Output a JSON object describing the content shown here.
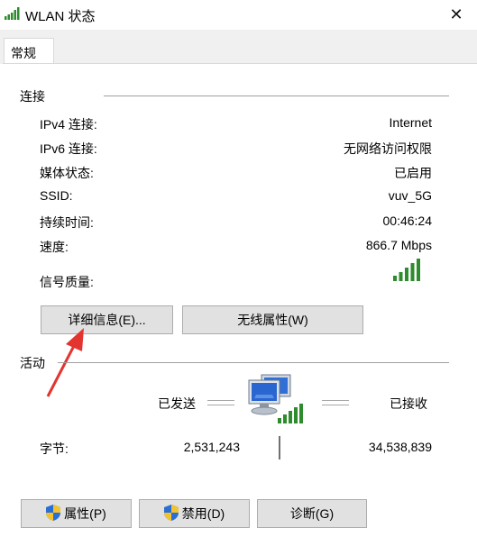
{
  "window": {
    "title": "WLAN 状态",
    "close_symbol": "✕"
  },
  "tabs": [
    {
      "label": "常规"
    }
  ],
  "connection": {
    "title": "连接",
    "rows": [
      {
        "label": "IPv4 连接:",
        "value": "Internet"
      },
      {
        "label": "IPv6 连接:",
        "value": "无网络访问权限"
      },
      {
        "label": "媒体状态:",
        "value": "已启用"
      },
      {
        "label": "SSID:",
        "value": "vuv_5G"
      },
      {
        "label": "持续时间:",
        "value": "00:46:24"
      },
      {
        "label": "速度:",
        "value": "866.7 Mbps"
      }
    ],
    "signal_label": "信号质量:",
    "signal_bars": 5,
    "details_button": "详细信息(E)...",
    "wireless_props_button": "无线属性(W)"
  },
  "activity": {
    "title": "活动",
    "sent_label": "已发送",
    "received_label": "已接收",
    "bytes_label": "字节:",
    "bytes_sent": "2,531,243",
    "bytes_received": "34,538,839"
  },
  "bottom_buttons": {
    "properties": "属性(P)",
    "disable": "禁用(D)",
    "diagnose": "诊断(G)"
  },
  "colors": {
    "accent_green": "#2e8b2e",
    "arrow_red": "#e3342f",
    "button_bg": "#e1e1e1"
  },
  "icons": {
    "title": "wifi-signal-icon",
    "network": "network-computers-icon",
    "shield": "uac-shield-icon"
  }
}
